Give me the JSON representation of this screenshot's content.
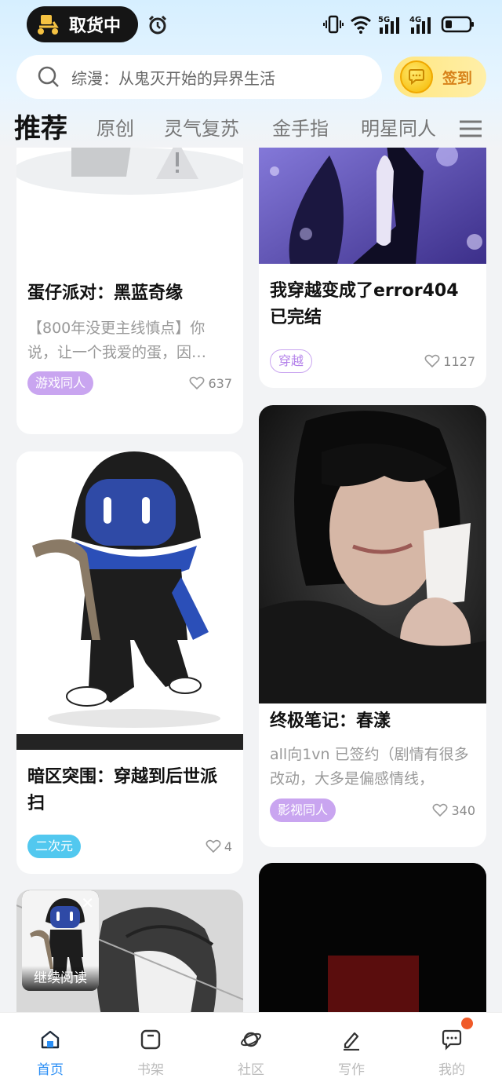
{
  "status_bar": {
    "pill_text": "取货中",
    "signal_labels": [
      "5G",
      "4G"
    ]
  },
  "search": {
    "placeholder_text": "综漫：从鬼灭开始的异界生活",
    "checkin_label": "签到"
  },
  "tabs": [
    "推荐",
    "原创",
    "灵气复苏",
    "金手指",
    "明星同人"
  ],
  "cards": [
    {
      "title": "蛋仔派对：黑蓝奇缘",
      "desc": "【800年没更主线慎点】你说，让一个我爱的蛋，因…",
      "tag": "游戏同人",
      "likes": "637"
    },
    {
      "title": "我穿越变成了error404已完结",
      "tag": "穿越",
      "likes": "1127"
    },
    {
      "title": "暗区突围：穿越到后世派扫",
      "tag": "二次元",
      "likes": "4"
    },
    {
      "title": "终极笔记：春漾",
      "desc": "all向1vn 已签约（剧情有很多改动，大多是偏感情线，",
      "tag": "影视同人",
      "likes": "340"
    }
  ],
  "continue_reading": {
    "label": "继续阅读"
  },
  "bottom_nav": [
    {
      "label": "首页",
      "icon": "home-icon",
      "active": true
    },
    {
      "label": "书架",
      "icon": "bookshelf-icon",
      "active": false
    },
    {
      "label": "社区",
      "icon": "planet-icon",
      "active": false
    },
    {
      "label": "写作",
      "icon": "pen-icon",
      "active": false
    },
    {
      "label": "我的",
      "icon": "chat-bubble-icon",
      "active": false
    }
  ],
  "colors": {
    "accent": "#2a8ef5",
    "tag_purple": "#c9a5f0",
    "tag_cyan": "#52c8ef",
    "checkin": "#d7821a",
    "badge": "#f05a28"
  }
}
